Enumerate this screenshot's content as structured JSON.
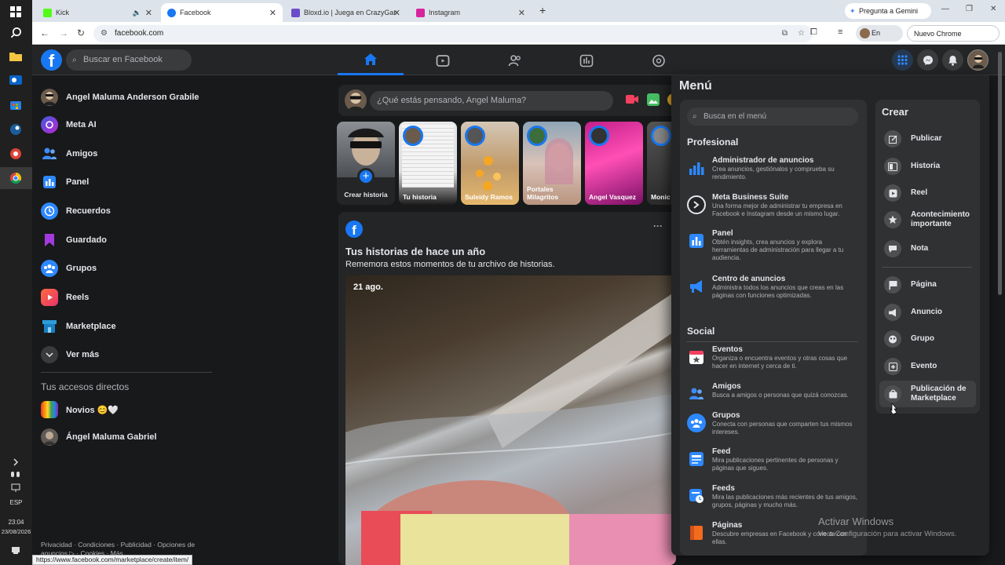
{
  "taskbar": {
    "time": "23:04",
    "date": "23/08/2026",
    "language": "ESP"
  },
  "browser": {
    "tabs": [
      {
        "label": "Kick",
        "color": "#53fc18"
      },
      {
        "label": "Facebook",
        "color": "#1877f2"
      },
      {
        "label": "Bloxd.io | Juega en CrazyGam",
        "color": "#6a4cc9"
      },
      {
        "label": "Instagram",
        "color": "#d6249f"
      }
    ],
    "new_tab": "+",
    "gemini_label": "Pregunta a Gemini",
    "url": "facebook.com",
    "profile_status": "En pausa",
    "update_label": "Nuevo Chrome disponible",
    "status_url": "https://www.facebook.com/marketplace/create/item/"
  },
  "fb": {
    "search_placeholder": "Buscar en Facebook",
    "accent": "#1877f2"
  },
  "sidebar": {
    "items": [
      {
        "label": "Angel Maluma Anderson Grabile",
        "icon": "avatar"
      },
      {
        "label": "Meta AI",
        "icon": "meta-ai-icon"
      },
      {
        "label": "Amigos",
        "icon": "friends-icon"
      },
      {
        "label": "Panel",
        "icon": "panel-icon"
      },
      {
        "label": "Recuerdos",
        "icon": "memories-icon"
      },
      {
        "label": "Guardado",
        "icon": "saved-icon"
      },
      {
        "label": "Grupos",
        "icon": "groups-icon"
      },
      {
        "label": "Reels",
        "icon": "reels-icon"
      },
      {
        "label": "Marketplace",
        "icon": "marketplace-icon"
      },
      {
        "label": "Ver más",
        "icon": "chevron-down-icon"
      }
    ],
    "shortcuts_title": "Tus accesos directos",
    "shortcuts": [
      {
        "label": "Novios 😊🤍"
      },
      {
        "label": "Ángel Maluma Gabriel"
      }
    ],
    "footer": "Privacidad · Condiciones · Publicidad · Opciones de anuncios ▷ · Cookies · Más"
  },
  "composer": {
    "placeholder": "¿Qué estás pensando, Angel Maluma?"
  },
  "stories": [
    {
      "label": "Crear historia"
    },
    {
      "label": "Tu historia"
    },
    {
      "label": "Suleidy Ramos"
    },
    {
      "label": "Portales Milagritos"
    },
    {
      "label": "Angel Vasquez"
    },
    {
      "label": "Monic Cherre"
    }
  ],
  "memory": {
    "title": "Tus historias de hace un año",
    "subtitle": "Rememora estos momentos de tu archivo de historias.",
    "date": "21 ago.",
    "more": "···"
  },
  "menu": {
    "title": "Menú",
    "search_placeholder": "Busca en el menú",
    "professional_title": "Profesional",
    "professional": [
      {
        "title": "Administrador de anuncios",
        "desc": "Crea anuncios, gestiónalos y comprueba su rendimiento."
      },
      {
        "title": "Meta Business Suite",
        "desc": "Una forma mejor de administrar tu empresa en Facebook e Instagram desde un mismo lugar."
      },
      {
        "title": "Panel",
        "desc": "Obtén insights, crea anuncios y explora herramientas de administración para llegar a tu audiencia."
      },
      {
        "title": "Centro de anuncios",
        "desc": "Administra todos los anuncios que creas en las páginas con funciones optimizadas."
      }
    ],
    "social_title": "Social",
    "social": [
      {
        "title": "Eventos",
        "desc": "Organiza o encuentra eventos y otras cosas que hacer en internet y cerca de ti."
      },
      {
        "title": "Amigos",
        "desc": "Busca a amigos o personas que quizá conozcas."
      },
      {
        "title": "Grupos",
        "desc": "Conecta con personas que comparten tus mismos intereses."
      },
      {
        "title": "Feed",
        "desc": "Mira publicaciones pertinentes de personas y páginas que sigues."
      },
      {
        "title": "Feeds",
        "desc": "Mira las publicaciones más recientes de tus amigos, grupos, páginas y mucho más."
      },
      {
        "title": "Páginas",
        "desc": "Descubre empresas en Facebook y conecta con ellas."
      }
    ],
    "create_title": "Crear",
    "create": [
      {
        "label": "Publicar"
      },
      {
        "label": "Historia"
      },
      {
        "label": "Reel"
      },
      {
        "label": "Acontecimiento importante"
      },
      {
        "label": "Nota"
      },
      {
        "label": "Página"
      },
      {
        "label": "Anuncio"
      },
      {
        "label": "Grupo"
      },
      {
        "label": "Evento"
      },
      {
        "label": "Publicación de Marketplace"
      }
    ]
  },
  "watermark": {
    "title": "Activar Windows",
    "subtitle": "Ve a Configuración para activar Windows."
  }
}
